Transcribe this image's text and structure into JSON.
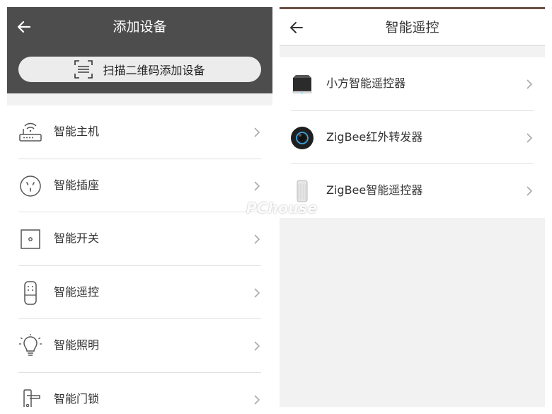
{
  "left": {
    "title": "添加设备",
    "scan_label": "扫描二维码添加设备",
    "items": [
      {
        "label": "智能主机",
        "icon": "router-icon"
      },
      {
        "label": "智能插座",
        "icon": "socket-icon"
      },
      {
        "label": "智能开关",
        "icon": "switch-icon"
      },
      {
        "label": "智能遥控",
        "icon": "remote-icon"
      },
      {
        "label": "智能照明",
        "icon": "bulb-icon"
      },
      {
        "label": "智能门锁",
        "icon": "door-lock-icon"
      }
    ]
  },
  "right": {
    "title": "智能遥控",
    "items": [
      {
        "label": "小方智能遥控器",
        "icon": "cube-remote-icon"
      },
      {
        "label": "ZigBee红外转发器",
        "icon": "ir-transmitter-icon"
      },
      {
        "label": "ZigBee智能遥控器",
        "icon": "cylinder-remote-icon"
      }
    ]
  },
  "watermark": "PChouse",
  "colors": {
    "header_dark": "#4d4d4d",
    "scan_button_bg": "#ececec",
    "page_gray": "#f2f2f2",
    "divider": "#e0e0e0"
  }
}
